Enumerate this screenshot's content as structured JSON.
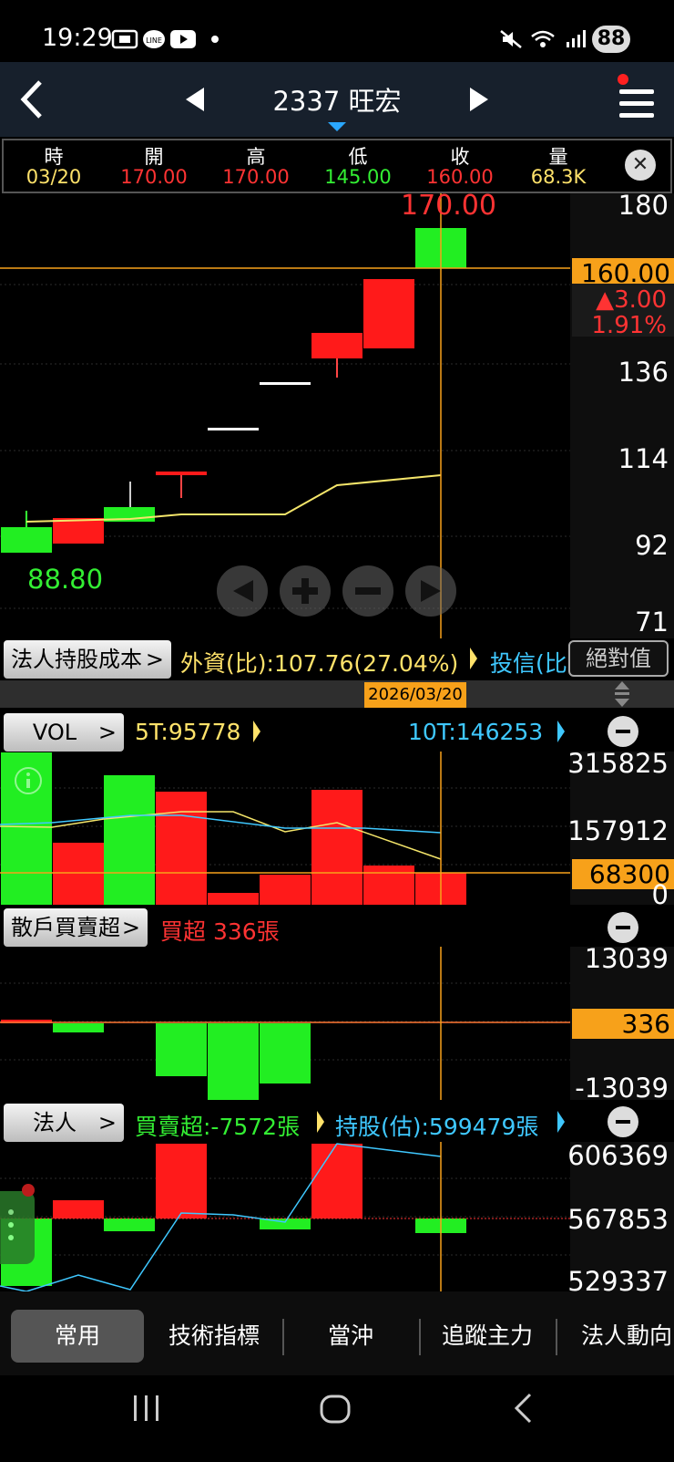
{
  "status": {
    "time": "19:29",
    "battery": "88"
  },
  "header": {
    "title": "2337 旺宏"
  },
  "quote": {
    "headers": [
      "時",
      "開",
      "高",
      "低",
      "收",
      "量"
    ],
    "values": [
      "03/20",
      "170.00",
      "170.00",
      "145.00",
      "160.00",
      "68.3K"
    ],
    "colors": [
      "#ffe26a",
      "#ff3333",
      "#ff3333",
      "#33ee33",
      "#ff3333",
      "#ffe26a"
    ]
  },
  "price_chart": {
    "axis": [
      "180",
      "136",
      "114",
      "92",
      "71"
    ],
    "current": "160.00",
    "change": "▲3.00",
    "change_pct": "1.91%",
    "high_label": "170.00",
    "low_label": "88.80"
  },
  "institution_cost": {
    "button": "法人持股成本",
    "foreign": "外資(比):107.76(27.04%)",
    "trust": "投信(比",
    "abs_button": "絕對值"
  },
  "date_tag": "2026/03/20",
  "volume": {
    "button": "VOL",
    "ma5": "5T:95778",
    "ma10": "10T:146253",
    "axis": [
      "315825",
      "157912",
      "0"
    ],
    "current": "68300"
  },
  "retail": {
    "button": "散戶買賣超",
    "summary": "買超 336張",
    "axis": [
      "13039",
      "-13039"
    ],
    "current": "336"
  },
  "institution": {
    "button": "法人",
    "net": "買賣超:-7572張",
    "holding": "持股(估):599479張",
    "axis": [
      "606369",
      "567853",
      "529337"
    ]
  },
  "tabs": [
    "常用",
    "技術指標",
    "當沖",
    "追蹤主力",
    "法人動向"
  ]
}
